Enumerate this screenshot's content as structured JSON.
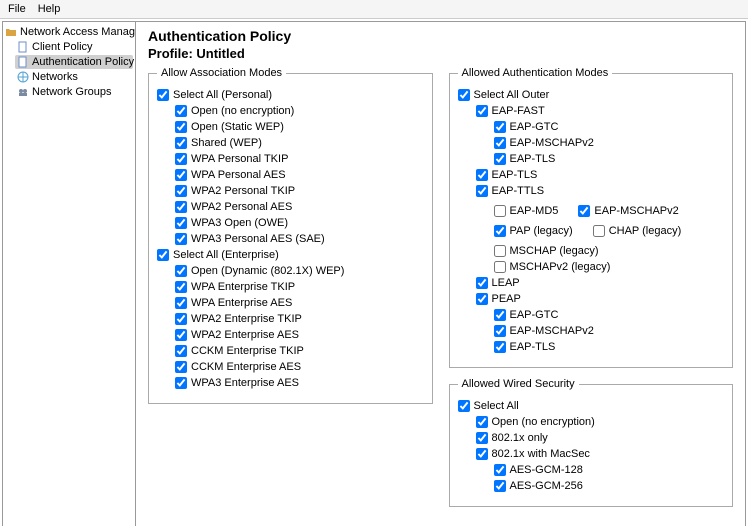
{
  "menubar": {
    "file": "File",
    "help": "Help"
  },
  "tree": {
    "root": "Network Access Manager",
    "items": [
      {
        "label": "Client Policy",
        "selected": false
      },
      {
        "label": "Authentication Policy",
        "selected": true
      },
      {
        "label": "Networks",
        "selected": false
      },
      {
        "label": "Network Groups",
        "selected": false
      }
    ]
  },
  "header": {
    "title": "Authentication Policy",
    "profile": "Profile:  Untitled"
  },
  "association": {
    "legend": "Allow Association Modes",
    "select_all_personal": "Select All (Personal)",
    "open_none": "Open (no encryption)",
    "open_static_wep": "Open (Static WEP)",
    "shared_wep": "Shared (WEP)",
    "wpa_p_tkip": "WPA Personal TKIP",
    "wpa_p_aes": "WPA Personal AES",
    "wpa2_p_tkip": "WPA2 Personal TKIP",
    "wpa2_p_aes": "WPA2 Personal AES",
    "wpa3_open": "WPA3 Open (OWE)",
    "wpa3_p_sae": "WPA3 Personal AES (SAE)",
    "select_all_ent": "Select All (Enterprise)",
    "open_dynamic_wep": "Open (Dynamic (802.1X) WEP)",
    "wpa_e_tkip": "WPA Enterprise TKIP",
    "wpa_e_aes": "WPA Enterprise AES",
    "wpa2_e_tkip": "WPA2 Enterprise TKIP",
    "wpa2_e_aes": "WPA2 Enterprise AES",
    "cckm_e_tkip": "CCKM Enterprise TKIP",
    "cckm_e_aes": "CCKM Enterprise AES",
    "wpa3_e_aes": "WPA3 Enterprise AES"
  },
  "auth": {
    "legend": "Allowed Authentication Modes",
    "select_all_outer": "Select All Outer",
    "eap_fast": "EAP-FAST",
    "eap_gtc": "EAP-GTC",
    "eap_mschapv2": "EAP-MSCHAPv2",
    "eap_tls": "EAP-TLS",
    "eap_ttls": "EAP-TTLS",
    "eap_md5": "EAP-MD5",
    "pap_legacy": "PAP (legacy)",
    "chap_legacy": "CHAP (legacy)",
    "mschap_legacy": "MSCHAP (legacy)",
    "mschapv2_legacy": "MSCHAPv2 (legacy)",
    "leap": "LEAP",
    "peap": "PEAP"
  },
  "wired": {
    "legend": "Allowed Wired Security",
    "select_all": "Select All",
    "open_none": "Open (no encryption)",
    "dot1x_only": "802.1x only",
    "dot1x_macsec": "802.1x with MacSec",
    "aes_gcm_128": "AES-GCM-128",
    "aes_gcm_256": "AES-GCM-256"
  }
}
